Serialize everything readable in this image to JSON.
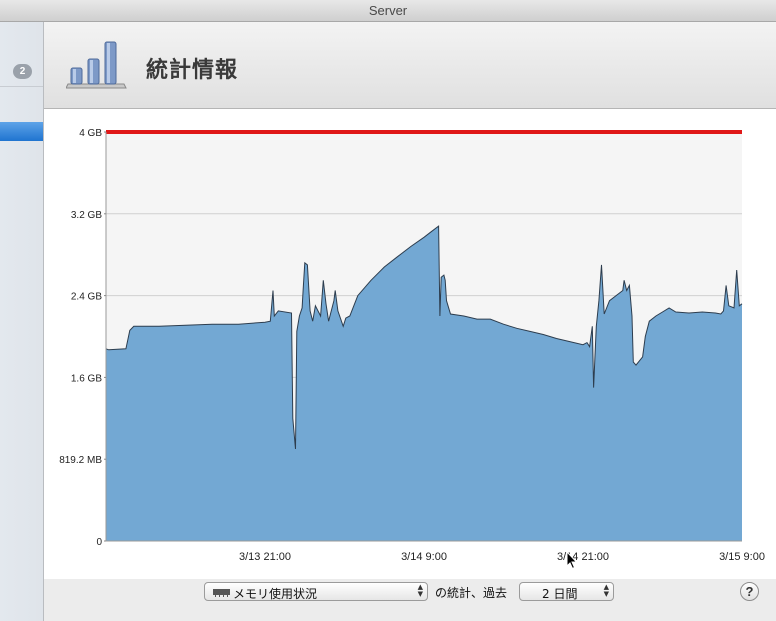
{
  "window": {
    "title": "Server"
  },
  "sidebar": {
    "badge": "2"
  },
  "header": {
    "title": "統計情報"
  },
  "controls": {
    "metric_select": "メモリ使用状況",
    "stats_of_text": "の統計、過去",
    "period_select": "2 日間",
    "help": "?"
  },
  "colors": {
    "fill": "#73a8d3",
    "limit_line": "#e01818",
    "plot_bg": "#f5f5f5"
  },
  "chart_data": {
    "type": "area",
    "title": "",
    "y_ticks": [
      "0",
      "819.2 MB",
      "1.6 GB",
      "2.4 GB",
      "3.2 GB",
      "4 GB"
    ],
    "y_tick_values_gb": [
      0,
      0.8,
      1.6,
      2.4,
      3.2,
      4.0
    ],
    "x_ticks": [
      "3/13 21:00",
      "3/14 9:00",
      "3/14 21:00",
      "3/15 9:00"
    ],
    "x_tick_hours": [
      12,
      24,
      36,
      48
    ],
    "xlim_hours": [
      0,
      48
    ],
    "ylim_gb": [
      0,
      4.0
    ],
    "limit_gb": 4.0,
    "unit": "GB",
    "series": [
      {
        "values": [
          [
            0,
            1.88
          ],
          [
            0.2,
            1.87
          ],
          [
            1.5,
            1.88
          ],
          [
            1.8,
            2.06
          ],
          [
            2.1,
            2.1
          ],
          [
            4,
            2.1
          ],
          [
            6,
            2.11
          ],
          [
            8,
            2.12
          ],
          [
            10,
            2.12
          ],
          [
            12,
            2.14
          ],
          [
            12.4,
            2.15
          ],
          [
            12.6,
            2.45
          ],
          [
            12.7,
            2.2
          ],
          [
            13,
            2.25
          ],
          [
            14,
            2.23
          ],
          [
            14.1,
            1.2
          ],
          [
            14.3,
            0.9
          ],
          [
            14.4,
            2.05
          ],
          [
            14.6,
            2.2
          ],
          [
            14.8,
            2.28
          ],
          [
            14.9,
            2.5
          ],
          [
            15,
            2.72
          ],
          [
            15.2,
            2.7
          ],
          [
            15.4,
            2.25
          ],
          [
            15.6,
            2.15
          ],
          [
            15.8,
            2.3
          ],
          [
            16.2,
            2.2
          ],
          [
            16.4,
            2.55
          ],
          [
            16.6,
            2.32
          ],
          [
            16.8,
            2.15
          ],
          [
            17.2,
            2.35
          ],
          [
            17.3,
            2.45
          ],
          [
            17.5,
            2.25
          ],
          [
            17.9,
            2.1
          ],
          [
            18.1,
            2.18
          ],
          [
            18.4,
            2.2
          ],
          [
            18.7,
            2.3
          ],
          [
            19,
            2.4
          ],
          [
            20,
            2.55
          ],
          [
            21,
            2.68
          ],
          [
            22,
            2.78
          ],
          [
            23,
            2.88
          ],
          [
            24,
            2.97
          ],
          [
            24.5,
            3.02
          ],
          [
            25.1,
            3.08
          ],
          [
            25.2,
            2.2
          ],
          [
            25.3,
            2.58
          ],
          [
            25.5,
            2.6
          ],
          [
            25.6,
            2.55
          ],
          [
            25.7,
            2.35
          ],
          [
            26,
            2.22
          ],
          [
            27,
            2.2
          ],
          [
            28,
            2.17
          ],
          [
            29,
            2.17
          ],
          [
            30,
            2.12
          ],
          [
            31,
            2.08
          ],
          [
            32,
            2.05
          ],
          [
            33,
            2.02
          ],
          [
            34,
            1.98
          ],
          [
            35,
            1.95
          ],
          [
            36,
            1.92
          ],
          [
            36.3,
            1.94
          ],
          [
            36.5,
            1.9
          ],
          [
            36.7,
            2.1
          ],
          [
            36.8,
            1.5
          ],
          [
            37,
            2.1
          ],
          [
            37.2,
            2.35
          ],
          [
            37.4,
            2.7
          ],
          [
            37.6,
            2.22
          ],
          [
            38,
            2.35
          ],
          [
            38.5,
            2.4
          ],
          [
            39,
            2.45
          ],
          [
            39.1,
            2.55
          ],
          [
            39.3,
            2.45
          ],
          [
            39.5,
            2.5
          ],
          [
            39.7,
            2.2
          ],
          [
            39.8,
            1.75
          ],
          [
            40,
            1.72
          ],
          [
            40.5,
            1.8
          ],
          [
            40.7,
            2.0
          ],
          [
            41,
            2.15
          ],
          [
            41.5,
            2.2
          ],
          [
            42,
            2.24
          ],
          [
            42.5,
            2.28
          ],
          [
            43,
            2.24
          ],
          [
            44,
            2.23
          ],
          [
            45,
            2.24
          ],
          [
            46,
            2.23
          ],
          [
            46.4,
            2.22
          ],
          [
            46.6,
            2.25
          ],
          [
            46.8,
            2.5
          ],
          [
            47,
            2.3
          ],
          [
            47.4,
            2.28
          ],
          [
            47.6,
            2.65
          ],
          [
            47.8,
            2.3
          ],
          [
            48,
            2.32
          ]
        ]
      }
    ]
  }
}
